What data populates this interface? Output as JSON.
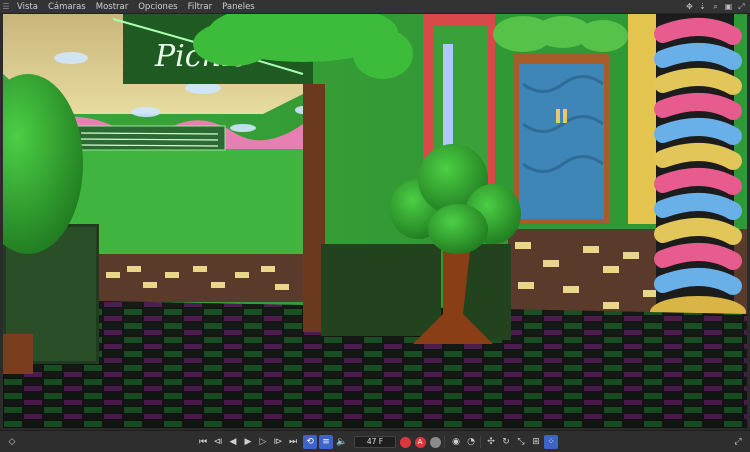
{
  "menu": {
    "items": [
      "Vista",
      "Cámaras",
      "Mostrar",
      "Opciones",
      "Filtrar",
      "Paneles"
    ]
  },
  "viewport": {
    "sign_text": "Picnic"
  },
  "transport": {
    "current_frame": "47 F",
    "record_label": "A"
  },
  "colors": {
    "accent": "#3e63c9",
    "record": "#d9373c",
    "panel_bg": "#2e2e2e"
  },
  "icons": {
    "menu_grip": "grip-icon",
    "top_right": [
      "hand-pan-icon",
      "move-down-icon",
      "zoom-icon",
      "frame-icon",
      "maximize-icon"
    ],
    "left_corner": "diamond-icon",
    "right_corner": "expand-icon"
  }
}
